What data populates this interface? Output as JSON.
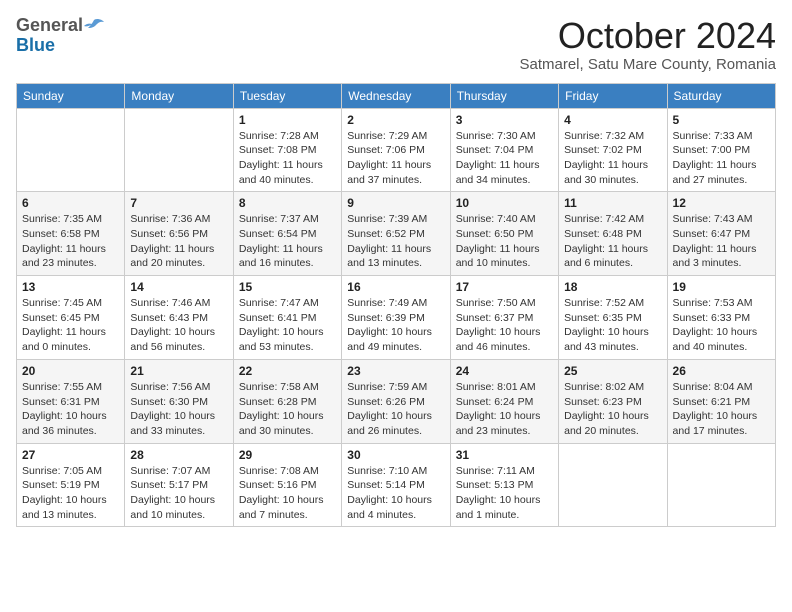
{
  "header": {
    "logo_general": "General",
    "logo_blue": "Blue",
    "month_title": "October 2024",
    "location": "Satmarel, Satu Mare County, Romania"
  },
  "days_of_week": [
    "Sunday",
    "Monday",
    "Tuesday",
    "Wednesday",
    "Thursday",
    "Friday",
    "Saturday"
  ],
  "weeks": [
    [
      {
        "day": "",
        "info": ""
      },
      {
        "day": "",
        "info": ""
      },
      {
        "day": "1",
        "info": "Sunrise: 7:28 AM\nSunset: 7:08 PM\nDaylight: 11 hours and 40 minutes."
      },
      {
        "day": "2",
        "info": "Sunrise: 7:29 AM\nSunset: 7:06 PM\nDaylight: 11 hours and 37 minutes."
      },
      {
        "day": "3",
        "info": "Sunrise: 7:30 AM\nSunset: 7:04 PM\nDaylight: 11 hours and 34 minutes."
      },
      {
        "day": "4",
        "info": "Sunrise: 7:32 AM\nSunset: 7:02 PM\nDaylight: 11 hours and 30 minutes."
      },
      {
        "day": "5",
        "info": "Sunrise: 7:33 AM\nSunset: 7:00 PM\nDaylight: 11 hours and 27 minutes."
      }
    ],
    [
      {
        "day": "6",
        "info": "Sunrise: 7:35 AM\nSunset: 6:58 PM\nDaylight: 11 hours and 23 minutes."
      },
      {
        "day": "7",
        "info": "Sunrise: 7:36 AM\nSunset: 6:56 PM\nDaylight: 11 hours and 20 minutes."
      },
      {
        "day": "8",
        "info": "Sunrise: 7:37 AM\nSunset: 6:54 PM\nDaylight: 11 hours and 16 minutes."
      },
      {
        "day": "9",
        "info": "Sunrise: 7:39 AM\nSunset: 6:52 PM\nDaylight: 11 hours and 13 minutes."
      },
      {
        "day": "10",
        "info": "Sunrise: 7:40 AM\nSunset: 6:50 PM\nDaylight: 11 hours and 10 minutes."
      },
      {
        "day": "11",
        "info": "Sunrise: 7:42 AM\nSunset: 6:48 PM\nDaylight: 11 hours and 6 minutes."
      },
      {
        "day": "12",
        "info": "Sunrise: 7:43 AM\nSunset: 6:47 PM\nDaylight: 11 hours and 3 minutes."
      }
    ],
    [
      {
        "day": "13",
        "info": "Sunrise: 7:45 AM\nSunset: 6:45 PM\nDaylight: 11 hours and 0 minutes."
      },
      {
        "day": "14",
        "info": "Sunrise: 7:46 AM\nSunset: 6:43 PM\nDaylight: 10 hours and 56 minutes."
      },
      {
        "day": "15",
        "info": "Sunrise: 7:47 AM\nSunset: 6:41 PM\nDaylight: 10 hours and 53 minutes."
      },
      {
        "day": "16",
        "info": "Sunrise: 7:49 AM\nSunset: 6:39 PM\nDaylight: 10 hours and 49 minutes."
      },
      {
        "day": "17",
        "info": "Sunrise: 7:50 AM\nSunset: 6:37 PM\nDaylight: 10 hours and 46 minutes."
      },
      {
        "day": "18",
        "info": "Sunrise: 7:52 AM\nSunset: 6:35 PM\nDaylight: 10 hours and 43 minutes."
      },
      {
        "day": "19",
        "info": "Sunrise: 7:53 AM\nSunset: 6:33 PM\nDaylight: 10 hours and 40 minutes."
      }
    ],
    [
      {
        "day": "20",
        "info": "Sunrise: 7:55 AM\nSunset: 6:31 PM\nDaylight: 10 hours and 36 minutes."
      },
      {
        "day": "21",
        "info": "Sunrise: 7:56 AM\nSunset: 6:30 PM\nDaylight: 10 hours and 33 minutes."
      },
      {
        "day": "22",
        "info": "Sunrise: 7:58 AM\nSunset: 6:28 PM\nDaylight: 10 hours and 30 minutes."
      },
      {
        "day": "23",
        "info": "Sunrise: 7:59 AM\nSunset: 6:26 PM\nDaylight: 10 hours and 26 minutes."
      },
      {
        "day": "24",
        "info": "Sunrise: 8:01 AM\nSunset: 6:24 PM\nDaylight: 10 hours and 23 minutes."
      },
      {
        "day": "25",
        "info": "Sunrise: 8:02 AM\nSunset: 6:23 PM\nDaylight: 10 hours and 20 minutes."
      },
      {
        "day": "26",
        "info": "Sunrise: 8:04 AM\nSunset: 6:21 PM\nDaylight: 10 hours and 17 minutes."
      }
    ],
    [
      {
        "day": "27",
        "info": "Sunrise: 7:05 AM\nSunset: 5:19 PM\nDaylight: 10 hours and 13 minutes."
      },
      {
        "day": "28",
        "info": "Sunrise: 7:07 AM\nSunset: 5:17 PM\nDaylight: 10 hours and 10 minutes."
      },
      {
        "day": "29",
        "info": "Sunrise: 7:08 AM\nSunset: 5:16 PM\nDaylight: 10 hours and 7 minutes."
      },
      {
        "day": "30",
        "info": "Sunrise: 7:10 AM\nSunset: 5:14 PM\nDaylight: 10 hours and 4 minutes."
      },
      {
        "day": "31",
        "info": "Sunrise: 7:11 AM\nSunset: 5:13 PM\nDaylight: 10 hours and 1 minute."
      },
      {
        "day": "",
        "info": ""
      },
      {
        "day": "",
        "info": ""
      }
    ]
  ]
}
